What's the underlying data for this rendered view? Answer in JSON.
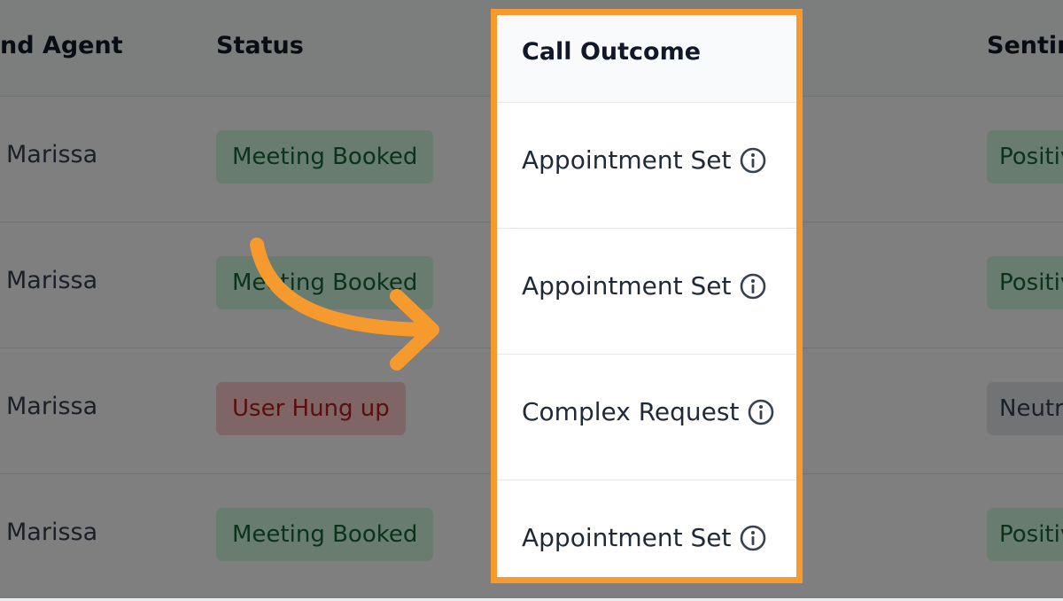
{
  "columns": {
    "agent": "nd Agent",
    "status": "Status",
    "outcome": "Call Outcome",
    "sentiment": "Sentim"
  },
  "rows": [
    {
      "agent": "Marissa",
      "status": "Meeting Booked",
      "status_tone": "green",
      "outcome": "Appointment Set",
      "sentiment": "Positiv",
      "sentiment_tone": "green"
    },
    {
      "agent": "Marissa",
      "status": "Meeting Booked",
      "status_tone": "green",
      "outcome": "Appointment Set",
      "sentiment": "Positiv",
      "sentiment_tone": "green"
    },
    {
      "agent": "Marissa",
      "status": "User Hung up",
      "status_tone": "red",
      "outcome": "Complex Request",
      "sentiment": "Neutra",
      "sentiment_tone": "gray"
    },
    {
      "agent": "Marissa",
      "status": "Meeting Booked",
      "status_tone": "green",
      "outcome": "Appointment Set",
      "sentiment": "Positiv",
      "sentiment_tone": "green"
    }
  ],
  "highlight": {
    "color": "#f79a2d",
    "column": "outcome",
    "arrow_icon": "curved-arrow-icon"
  },
  "icons": {
    "outcome_info": "info-circle-icon"
  }
}
